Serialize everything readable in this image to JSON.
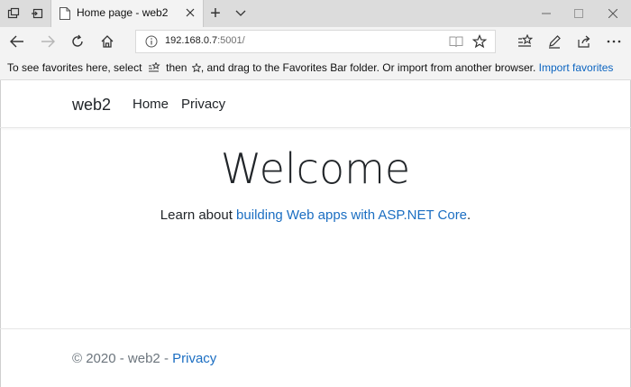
{
  "window": {
    "tab_title": "Home page - web2",
    "new_tab_symbol": "+",
    "tab_menu_symbol": "⌄"
  },
  "toolbar": {
    "url_host": "192.168.0.7",
    "url_rest": ":5001/"
  },
  "favbar": {
    "text_before_star": "To see favorites here, select",
    "text_after_star": "then",
    "text_end": ", and drag to the Favorites Bar folder. Or import from another browser.",
    "import_link": "Import favorites"
  },
  "site": {
    "brand": "web2",
    "nav": [
      "Home",
      "Privacy"
    ],
    "heading": "Welcome",
    "learn_prefix": "Learn about ",
    "learn_link": "building Web apps with ASP.NET Core",
    "learn_suffix": ".",
    "footer_prefix": "© 2020 - web2 - ",
    "footer_link": "Privacy"
  },
  "colors": {
    "link": "#1b6ec2",
    "favbar_link": "#0b64c0",
    "chrome_bg": "#f3f3f3",
    "titlebar_bg": "#dcdcdc"
  },
  "icons": {
    "titlebar": [
      "set-aside-tabs-icon",
      "tab-preview-icon",
      "page-favicon"
    ],
    "nav": [
      "back-icon",
      "forward-icon",
      "refresh-icon",
      "home-icon"
    ],
    "address": [
      "site-info-icon",
      "reading-view-icon",
      "favorite-star-icon"
    ],
    "right": [
      "favorites-hub-icon",
      "notes-pen-icon",
      "share-icon",
      "more-dots-icon"
    ],
    "window": [
      "minimize-icon",
      "maximize-icon",
      "close-icon"
    ]
  }
}
